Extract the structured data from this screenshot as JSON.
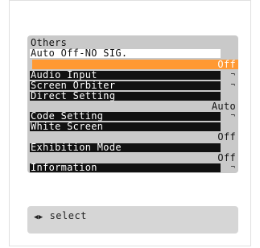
{
  "menu": {
    "title": "Others",
    "items": [
      {
        "label": "Auto Off-NO SIG.",
        "value": "Off"
      },
      {
        "label": "Audio Input",
        "submenu_mark": "¬"
      },
      {
        "label": "Screen Orbiter",
        "submenu_mark": "¬"
      },
      {
        "label": "Direct Setting",
        "value": "Auto"
      },
      {
        "label": "Code Setting",
        "submenu_mark": "¬"
      },
      {
        "label": "White Screen",
        "value": "Off"
      },
      {
        "label": "Exhibition Mode",
        "value": "Off"
      },
      {
        "label": "Information",
        "submenu_mark": "¬"
      }
    ]
  },
  "hint": {
    "arrows": "◀▶",
    "text": "select"
  },
  "colors": {
    "panel": "#c9c9c9",
    "highlight": "#ff9933",
    "item_bg": "#111111"
  },
  "icons": {
    "submenu": "submenu-arrow-icon",
    "nav": "left-right-arrows-icon"
  }
}
